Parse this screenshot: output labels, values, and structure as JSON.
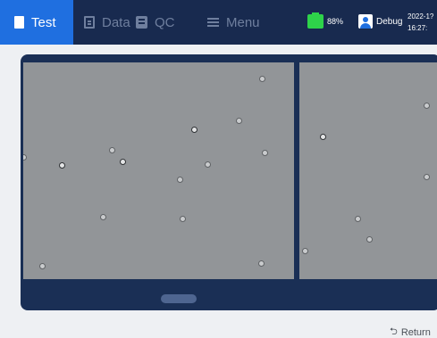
{
  "nav": {
    "tabs": [
      {
        "label": "Test",
        "icon": "document-icon",
        "active": true
      },
      {
        "label": "Data",
        "icon": "data-icon",
        "active": false
      },
      {
        "label": "QC",
        "icon": "qc-icon",
        "active": false
      },
      {
        "label": "Menu",
        "icon": "menu-icon",
        "active": false
      }
    ]
  },
  "status": {
    "battery_label": "88%",
    "battery_color": "#2ed34a",
    "user_label": "Debug",
    "date": "2022-1?",
    "time": "16:27:"
  },
  "viewer": {
    "images": [
      {
        "name": "microscope-field-1"
      },
      {
        "name": "microscope-field-2"
      }
    ]
  },
  "footer": {
    "return_label": "Return"
  },
  "colors": {
    "topbar": "#182a4f",
    "active_tab": "#1f6fe0",
    "viewer_bg": "#1a2f55",
    "image_bg": "#929598"
  }
}
